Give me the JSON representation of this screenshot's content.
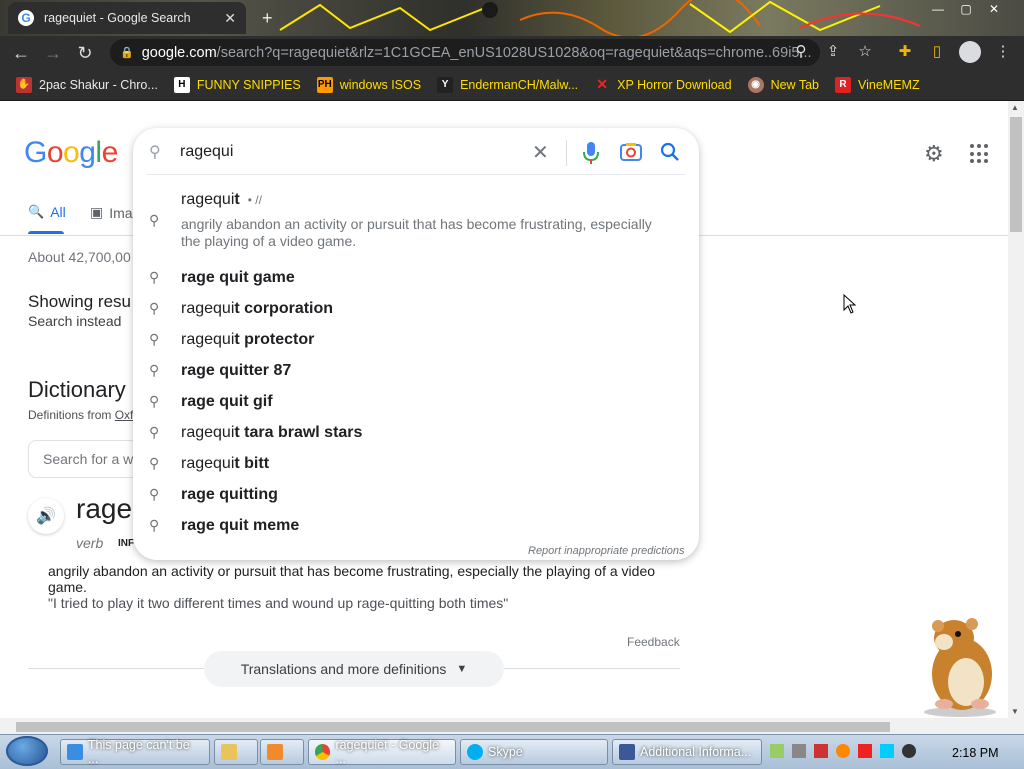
{
  "browser": {
    "tab_title": "ragequiet - Google Search",
    "tab_close": "✕",
    "new_tab": "+",
    "window_controls": [
      "—",
      "▢",
      "✕"
    ],
    "url_domain": "google.com",
    "url_path": "/search?q=ragequiet&rlz=1C1GCEA_enUS1028US1028&oq=ragequiet&aqs=chrome..69i5...",
    "bookmarks": [
      {
        "label": "2pac Shakur - Chro...",
        "icon": "hand-icon",
        "color": "#b33"
      },
      {
        "label": "FUNNY SNIPPIES",
        "icon": "h-icon",
        "color": "#222"
      },
      {
        "label": "windows ISOS",
        "icon": "ph-icon",
        "color": "#f90"
      },
      {
        "label": "EndermanCH/Malw...",
        "icon": "yt-icon",
        "color": "#222"
      },
      {
        "label": "XP Horror Download",
        "icon": "x-icon",
        "color": "#e22"
      },
      {
        "label": "New Tab",
        "icon": "globe-icon",
        "color": "#a76"
      },
      {
        "label": "VineMEMZ",
        "icon": "r-icon",
        "color": "#d22"
      }
    ]
  },
  "search": {
    "query": "ragequi",
    "top_suggestion": {
      "prefix": "ragequi",
      "bold": "t",
      "tag": "• //",
      "definition": "angrily abandon an activity or pursuit that has become frustrating, especially the playing of a video game."
    },
    "suggestions": [
      {
        "prefix": "",
        "bold": "rage quit game"
      },
      {
        "prefix": "ragequi",
        "bold": "t corporation"
      },
      {
        "prefix": "ragequi",
        "bold": "t protector"
      },
      {
        "prefix": "",
        "bold": "rage quitter 87"
      },
      {
        "prefix": "",
        "bold": "rage quit gif"
      },
      {
        "prefix": "ragequi",
        "bold": "t tara brawl stars"
      },
      {
        "prefix": "ragequi",
        "bold": "t bitt"
      },
      {
        "prefix": "",
        "bold": "rage quitting"
      },
      {
        "prefix": "",
        "bold": "rage quit meme"
      }
    ],
    "report": "Report inappropriate predictions"
  },
  "results": {
    "tab_all": "All",
    "tab_images": "Ima",
    "stats": "About 42,700,00",
    "showing": "Showing resu",
    "search_instead": "Search instead",
    "dictionary": "Dictionary",
    "definitions_from": "Definitions from",
    "oxford": "Oxf",
    "dict_search_placeholder": "Search for a w",
    "word": "rage",
    "pos": "verb",
    "inf": "INF",
    "definition": "angrily abandon an activity or pursuit that has become frustrating, especially the playing of a video game.",
    "example": "\"I tried to play it two different times and wound up rage-quitting both times\"",
    "feedback": "Feedback",
    "translations": "Translations and more definitions"
  },
  "taskbar": {
    "buttons": [
      {
        "label": "This page can't be ...",
        "icon": "ie-icon"
      },
      {
        "label": "",
        "icon": "folder-icon"
      },
      {
        "label": "",
        "icon": "media-icon"
      },
      {
        "label": "ragequiet - Google ...",
        "icon": "chrome-icon"
      },
      {
        "label": "Skype",
        "icon": "skype-icon"
      },
      {
        "label": "Additional Informa...",
        "icon": "window-icon"
      }
    ],
    "clock": "2:18 PM"
  },
  "colors": {
    "google_blue": "#4285f4",
    "google_red": "#ea4335",
    "google_yellow": "#fbbc05",
    "google_green": "#34a853",
    "link_blue": "#1a73e8"
  }
}
